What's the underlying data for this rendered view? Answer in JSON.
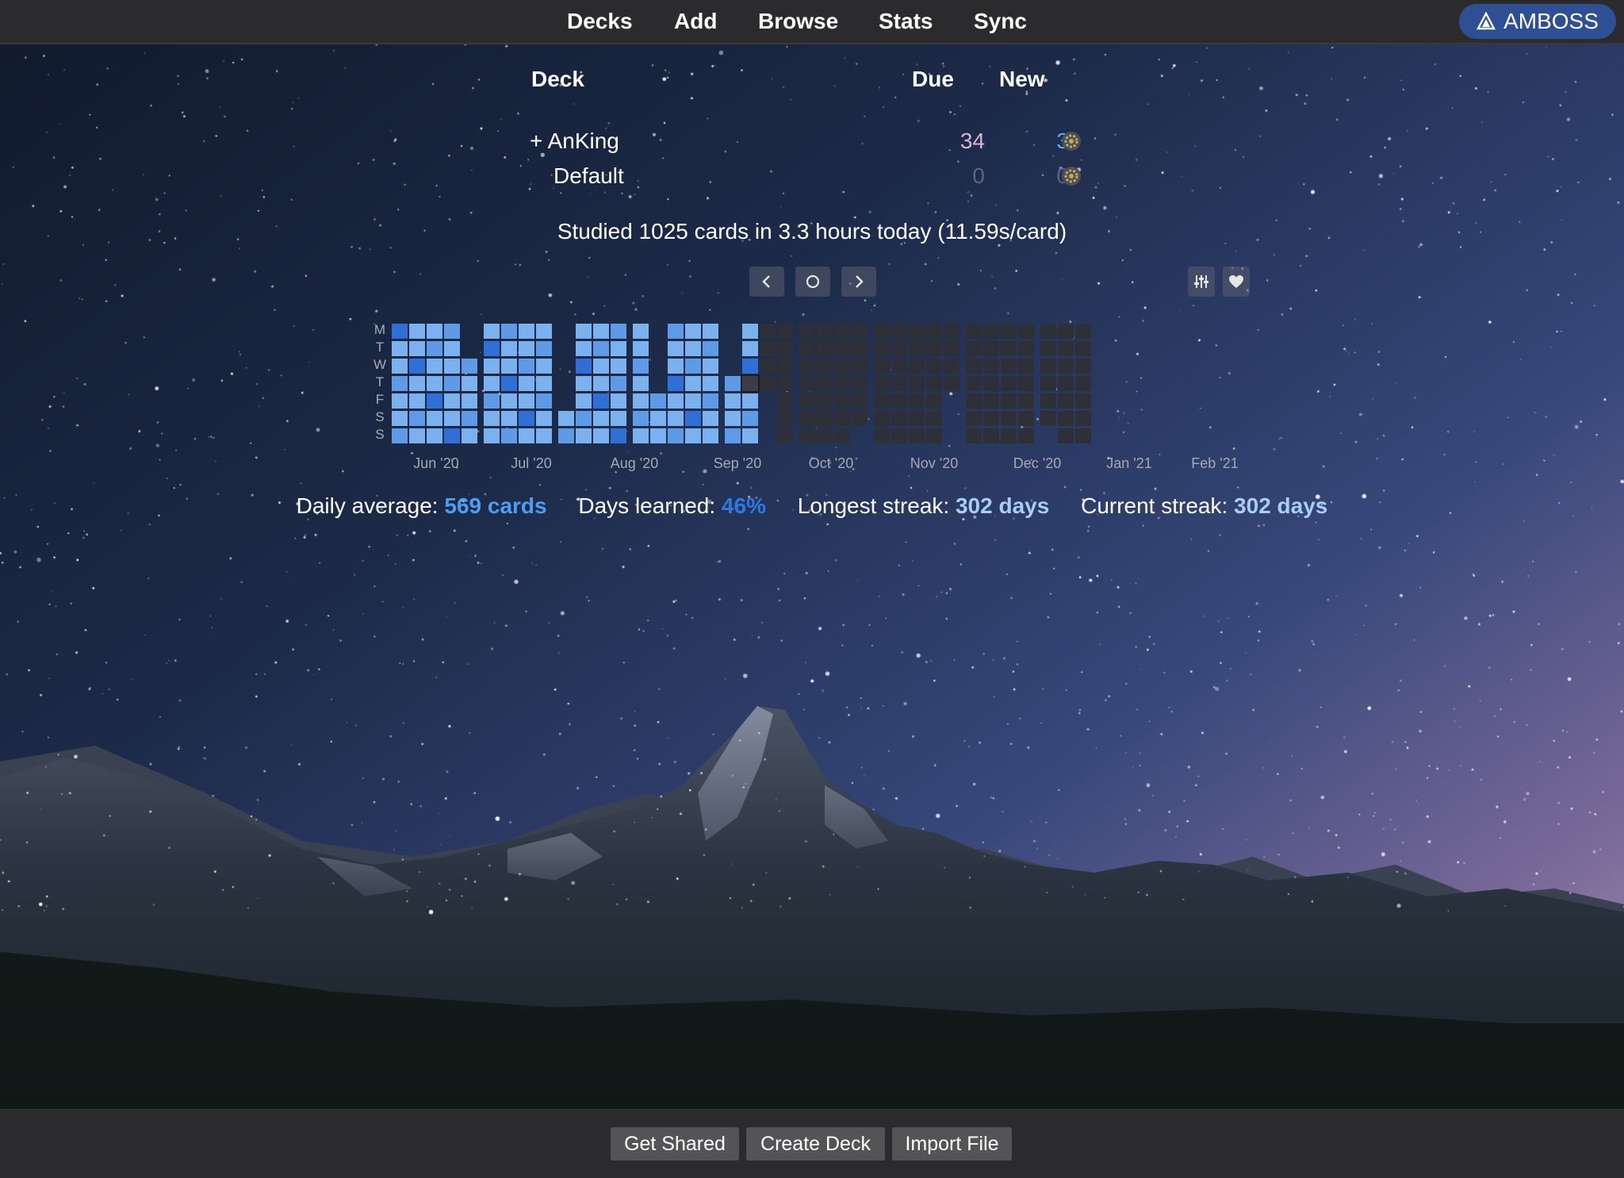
{
  "nav": {
    "items": [
      "Decks",
      "Add",
      "Browse",
      "Stats",
      "Sync"
    ],
    "amboss_label": "AMBOSS"
  },
  "deck_table": {
    "headers": {
      "deck": "Deck",
      "due": "Due",
      "new": "New"
    },
    "rows": [
      {
        "expander": "+",
        "name": "AnKing",
        "due": "34",
        "new": "3"
      },
      {
        "expander": "",
        "name": "Default",
        "due": "0",
        "new": "0"
      }
    ]
  },
  "studied_text": "Studied 1025 cards in 3.3 hours today (11.59s/card)",
  "heatmap": {
    "day_labels": [
      "M",
      "T",
      "W",
      "T",
      "F",
      "S",
      "S"
    ],
    "months": [
      "Jun '20",
      "Jul '20",
      "Aug '20",
      "Sep '20",
      "Oct '20",
      "Nov '20",
      "Dec '20",
      "Jan '21",
      "Feb '21"
    ],
    "controls": {
      "prev_icon": "chevron-left-icon",
      "today_icon": "circle-icon",
      "next_icon": "chevron-right-icon",
      "options_icon": "sliders-icon",
      "support_icon": "heart-icon"
    }
  },
  "stats": {
    "daily_average_label": "Daily average:",
    "daily_average_value": "569 cards",
    "days_learned_label": "Days learned:",
    "days_learned_value": "46%",
    "longest_streak_label": "Longest streak:",
    "longest_streak_value": "302 days",
    "current_streak_label": "Current streak:",
    "current_streak_value": "302 days"
  },
  "bottom": {
    "get_shared": "Get Shared",
    "create_deck": "Create Deck",
    "import_file": "Import File"
  },
  "colors": {
    "accent_blue": "#4a9ef2",
    "due_color": "#d8b7d3",
    "new_color": "#5fb0f2",
    "heat_light": "#7bb1ee",
    "heat_mid": "#5f9ae6",
    "heat_dark": "#2f6fd6",
    "heat_empty": "#2e3038",
    "stat_daily": "#4f9cf4",
    "stat_days": "#2f78e4",
    "stat_streak": "#a8cdf6"
  }
}
